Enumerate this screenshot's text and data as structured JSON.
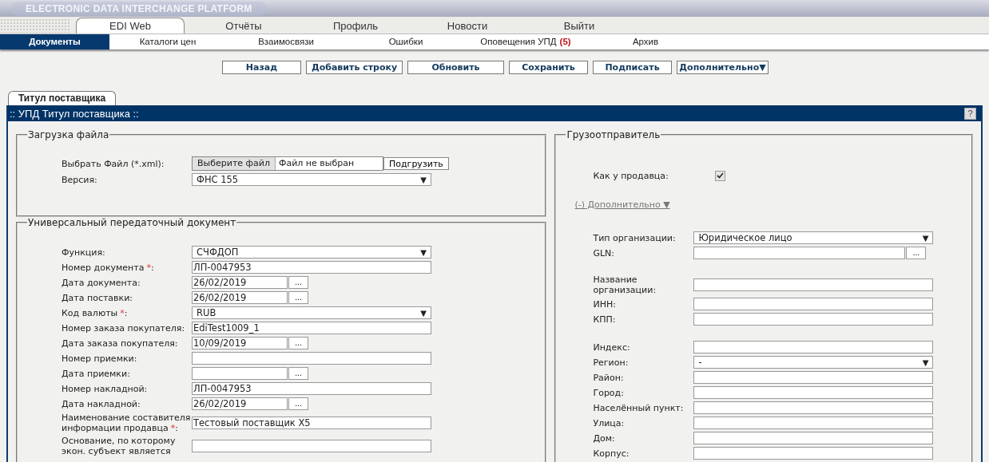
{
  "header": {
    "title": "ELECTRONIC DATA INTERCHANGE PLATFORM"
  },
  "top_nav": [
    {
      "label": "EDI Web",
      "selected": true
    },
    {
      "label": "Отчёты",
      "selected": false
    },
    {
      "label": "Профиль",
      "selected": false
    },
    {
      "label": "Новости",
      "selected": false
    },
    {
      "label": "Выйти",
      "selected": false
    }
  ],
  "sub_nav": [
    {
      "label": "Документы",
      "selected": true
    },
    {
      "label": "Каталоги цен",
      "selected": false
    },
    {
      "label": "Взаимосвязи",
      "selected": false
    },
    {
      "label": "Ошибки",
      "selected": false
    },
    {
      "label": "Оповещения УПД",
      "badge": "(5)",
      "selected": false
    },
    {
      "label": "Архив",
      "selected": false
    }
  ],
  "toolbar": [
    {
      "label": "Назад",
      "kind": "button"
    },
    {
      "label": "Добавить строку",
      "kind": "button"
    },
    {
      "label": "Обновить",
      "kind": "button"
    },
    {
      "label": "Сохранить",
      "kind": "button"
    },
    {
      "label": "Подписать",
      "kind": "button"
    },
    {
      "label": "Дополнительно",
      "caret": "▼",
      "kind": "dropdown"
    }
  ],
  "tabs": [
    {
      "label": "Титул поставщика",
      "selected": true
    }
  ],
  "panel": {
    "title": ":: УПД Титул поставщика ::",
    "help": "?"
  },
  "file_section": {
    "legend": "Загрузка файла",
    "rows": [
      {
        "label": "Выбрать Файл (*.xml):",
        "kind": "file",
        "button": "Выберите файл",
        "value": "Файл не выбран",
        "action": "Подгрузить"
      },
      {
        "label": "Версия:",
        "kind": "select",
        "value": "ФНС 155",
        "caret": "▼"
      }
    ]
  },
  "upd_section": {
    "legend": "Универсальный передаточный документ",
    "rows": [
      {
        "label": "Функция:",
        "kind": "select",
        "value": "СЧФДОП",
        "caret": "▼"
      },
      {
        "label": "Номер документа",
        "required": "*",
        "label_end": ":",
        "kind": "text",
        "value": "ЛП-0047953"
      },
      {
        "label": "Дата документа:",
        "kind": "date",
        "value": "26/02/2019",
        "button": "..."
      },
      {
        "label": "Дата поставки:",
        "kind": "date",
        "value": "26/02/2019",
        "button": "..."
      },
      {
        "label": "Код валюты",
        "required": "*",
        "label_end": ":",
        "kind": "select",
        "value": "RUB",
        "caret": "▼"
      },
      {
        "label": "Номер заказа покупателя:",
        "kind": "text",
        "value": "EdiTest1009_1"
      },
      {
        "label": "Дата заказа покупателя:",
        "kind": "date",
        "value": "10/09/2019",
        "button": "..."
      },
      {
        "label": "Номер приемки:",
        "kind": "text"
      },
      {
        "label": "Дата приемки:",
        "kind": "date",
        "button": "..."
      },
      {
        "label": "Номер накладной:",
        "kind": "text",
        "value": "ЛП-0047953"
      },
      {
        "label": "Дата накладной:",
        "kind": "date",
        "value": "26/02/2019",
        "button": "..."
      },
      {
        "label": "Наименование составителя информации продавца",
        "required": "*",
        "label_end": ":",
        "kind": "text",
        "value": "Тестовый поставщик X5"
      },
      {
        "label": "Основание, по которому экон. субъект является",
        "kind": "text"
      }
    ]
  },
  "shipper": {
    "legend": "Грузоотправитель",
    "same_as_seller": {
      "label": "Как у продавца:",
      "checked": true
    },
    "more_link": {
      "label": "(-) Дополнительно ▼"
    },
    "groups": [
      [
        {
          "label": "Тип организации:",
          "kind": "select",
          "value": "Юридическое лицо",
          "caret": "▼"
        },
        {
          "label": "GLN:",
          "kind": "lookup",
          "button": "..."
        }
      ],
      [
        {
          "label": "Название организации:",
          "kind": "text"
        },
        {
          "label": "ИНН:",
          "kind": "text"
        },
        {
          "label": "КПП:",
          "kind": "text"
        }
      ],
      [
        {
          "label": "Индекс:",
          "kind": "text"
        },
        {
          "label": "Регион:",
          "kind": "select",
          "value": "-",
          "caret": "▼"
        },
        {
          "label": "Район:",
          "kind": "text"
        },
        {
          "label": "Город:",
          "kind": "text"
        },
        {
          "label": "Населённый пункт:",
          "kind": "text"
        },
        {
          "label": "Улица:",
          "kind": "text"
        },
        {
          "label": "Дом:",
          "kind": "text"
        },
        {
          "label": "Корпус:",
          "kind": "text"
        }
      ]
    ]
  }
}
